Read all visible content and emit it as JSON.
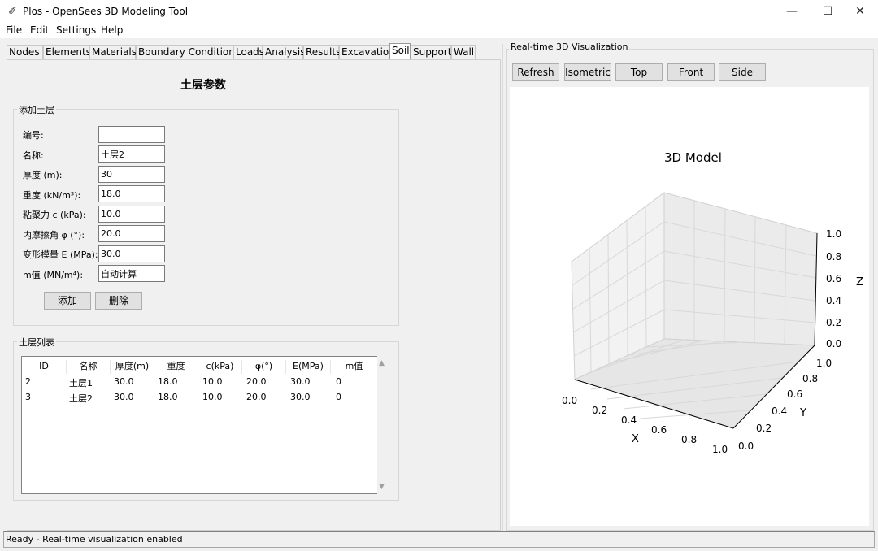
{
  "window": {
    "title": "Plos - OpenSees 3D Modeling Tool",
    "app_icon": "✐",
    "minimize": "—",
    "maximize": "☐",
    "close": "✕"
  },
  "menu": [
    "File",
    "Edit",
    "Settings",
    "Help"
  ],
  "tabs": [
    "Nodes",
    "Elements",
    "Materials",
    "Boundary Conditions",
    "Loads",
    "Analysis",
    "Results",
    "Excavation",
    "Soil",
    "Support",
    "Wall"
  ],
  "active_tab": "Soil",
  "soil": {
    "title": "土层参数",
    "add_group_label": "添加土层",
    "fields": [
      {
        "label": "编号:",
        "value": ""
      },
      {
        "label": "名称:",
        "value": "土层2"
      },
      {
        "label": "厚度 (m):",
        "value": "30"
      },
      {
        "label": "重度 (kN/m³):",
        "value": "18.0"
      },
      {
        "label": "粘聚力 c (kPa):",
        "value": "10.0"
      },
      {
        "label": "内摩擦角 φ (°):",
        "value": "20.0"
      },
      {
        "label": "变形模量 E (MPa):",
        "value": "30.0"
      },
      {
        "label": "m值 (MN/m⁴):",
        "value": "自动计算"
      }
    ],
    "add_button": "添加",
    "delete_button": "删除",
    "list_group_label": "土层列表",
    "columns": [
      "ID",
      "名称",
      "厚度(m)",
      "重度",
      "c(kPa)",
      "φ(°)",
      "E(MPa)",
      "m值"
    ],
    "rows": [
      [
        "2",
        "土层1",
        "30.0",
        "18.0",
        "10.0",
        "20.0",
        "30.0",
        "0"
      ],
      [
        "3",
        "土层2",
        "30.0",
        "18.0",
        "10.0",
        "20.0",
        "30.0",
        "0"
      ]
    ],
    "scroll_up": "▲",
    "scroll_down": "▼"
  },
  "viz": {
    "label": "Real-time 3D Visualization",
    "buttons": [
      "Refresh",
      "Isometric",
      "Top",
      "Front",
      "Side"
    ],
    "plot_title": "3D Model",
    "x_label": "X",
    "y_label": "Y",
    "z_label": "Z",
    "x_ticks": [
      "0.0",
      "0.2",
      "0.4",
      "0.6",
      "0.8",
      "1.0"
    ],
    "y_ticks": [
      "0.0",
      "0.2",
      "0.4",
      "0.6",
      "0.8",
      "1.0"
    ],
    "z_ticks": [
      "0.0",
      "0.2",
      "0.4",
      "0.6",
      "0.8",
      "1.0"
    ]
  },
  "status": "Ready - Real-time visualization enabled"
}
